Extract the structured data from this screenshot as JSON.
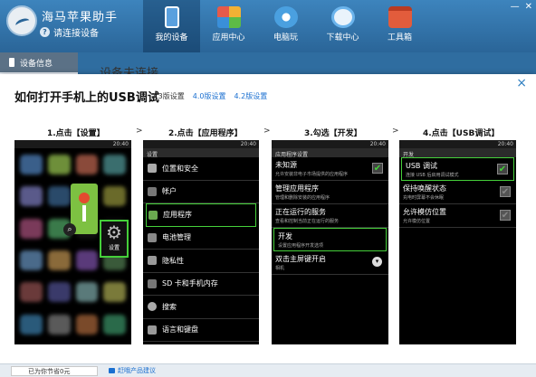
{
  "app": {
    "title": "海马苹果助手",
    "connect_status": "请连接设备"
  },
  "nav": {
    "items": [
      {
        "label": "我的设备",
        "icon": "device-icon",
        "active": true
      },
      {
        "label": "应用中心",
        "icon": "app-center-icon"
      },
      {
        "label": "电脑玩",
        "icon": "pc-play-icon"
      },
      {
        "label": "下载中心",
        "icon": "download-icon"
      },
      {
        "label": "工具箱",
        "icon": "toolbox-icon"
      }
    ]
  },
  "side": {
    "item_label": "设备信息"
  },
  "background": {
    "heading": "设备未连接"
  },
  "modal": {
    "title": "如何打开手机上的USB调试",
    "versions": [
      "2.3版设置",
      "4.0版设置",
      "4.2版设置"
    ],
    "close": "×"
  },
  "steps": [
    {
      "label": "1.点击【设置】"
    },
    {
      "label": "2.点击【应用程序】"
    },
    {
      "label": "3.勾选【开发】"
    },
    {
      "label": "4.点击【USB调试】"
    }
  ],
  "arrow": ">",
  "phone1": {
    "time": "20:40",
    "settings_label": "设置"
  },
  "phone2": {
    "time": "20:40",
    "header": "设置",
    "rows": [
      {
        "label": "位置和安全"
      },
      {
        "label": "帐户"
      },
      {
        "label": "应用程序",
        "highlight": true
      },
      {
        "label": "电池管理"
      },
      {
        "label": "隐私性"
      },
      {
        "label": "SD 卡和手机内存"
      },
      {
        "label": "搜索"
      },
      {
        "label": "语言和键盘"
      }
    ]
  },
  "phone3": {
    "time": "20:40",
    "header": "应用程序设置",
    "options": [
      {
        "title": "未知源",
        "sub": "允许安装非电子市场提供的应用程序",
        "control": "checked"
      },
      {
        "title": "管理应用程序",
        "sub": "管理和删除安装的应用程序"
      },
      {
        "title": "正在运行的服务",
        "sub": "查看和控制当前正在运行的服务"
      },
      {
        "title": "开发",
        "sub": "设置应用程序开发选项",
        "highlight": true
      },
      {
        "title": "双击主屏键开启",
        "sub": "相机",
        "control": "dropdown"
      }
    ]
  },
  "phone4": {
    "time": "20:40",
    "header": "开发",
    "options": [
      {
        "title": "USB 调试",
        "sub": "连接 USB 后启用调试模式",
        "control": "checked",
        "highlight": true
      },
      {
        "title": "保持唤醒状态",
        "sub": "充电时屏幕不会休眠",
        "control": "checked"
      },
      {
        "title": "允许模仿位置",
        "sub": "允许模仿位置",
        "control": "checked"
      }
    ]
  },
  "bottom": {
    "saved_text": "已为你节省0元",
    "feedback_text": "赶哦产品建议"
  }
}
